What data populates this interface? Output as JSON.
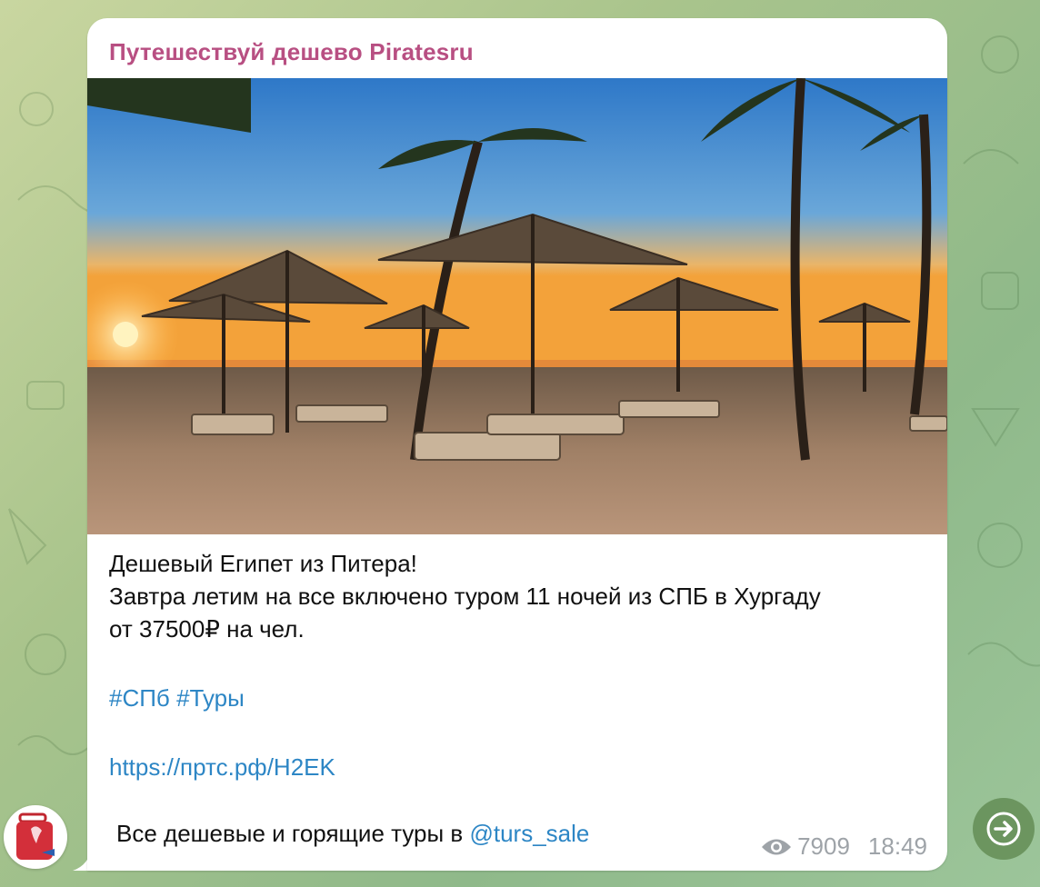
{
  "post": {
    "channel_name": "Путешествуй дешево Piratesru",
    "lines": {
      "line1": "Дешевый Египет из Питера!",
      "line2": "Завтра летим на все включено туром 11 ночей из СПБ в Хургаду",
      "line3": "от 37500₽ на чел."
    },
    "hashtags": [
      "#СПб",
      "#Туры"
    ],
    "link": "https://пртс.рф/H2EK",
    "footer_text": "Все дешевые и горящие туры в ",
    "footer_mention": "@turs_sale",
    "views": "7909",
    "time": "18:49"
  },
  "icons": {
    "views": "eye-icon",
    "share": "share-arrow-icon",
    "avatar": "suitcase-avatar"
  },
  "colors": {
    "channel_name": "#b84f82",
    "link": "#2d86c5",
    "meta": "#9ea3a8",
    "background": "#a9c48c"
  }
}
